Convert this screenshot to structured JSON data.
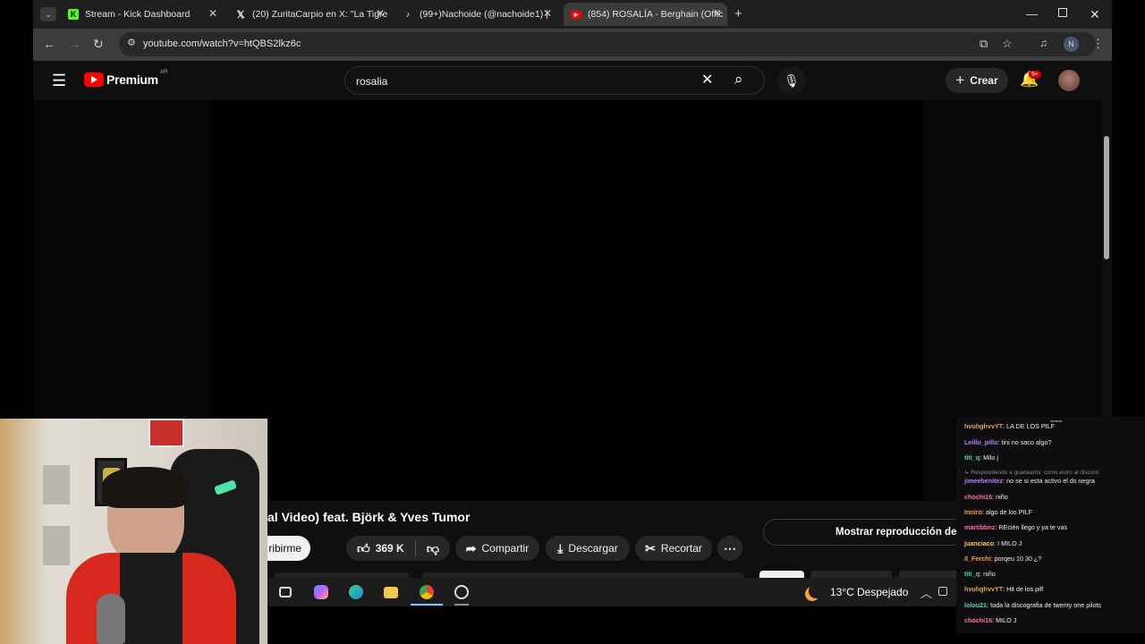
{
  "browser": {
    "tabs": [
      {
        "title": "Stream - Kick Dashboard",
        "active": false
      },
      {
        "title": "(20) ZuritaCarpio en X: \"La Tigre",
        "active": false
      },
      {
        "title": "(99+)Nachoide (@nachoide1) |",
        "active": false
      },
      {
        "title": "(854) ROSALÍA - Berghain (Offic",
        "active": true
      }
    ],
    "url": "youtube.com/watch?v=htQBS2lkz6c",
    "profile_initial": "N"
  },
  "youtube": {
    "logo_text": "Premium",
    "region": "AR",
    "search_value": "rosalia",
    "create_label": "Crear",
    "notif_badge": "9+",
    "video_title": "al Video) feat. Björk & Yves Tumor",
    "subscribe_label": "ribirme",
    "likes": "369 K",
    "share_label": "Compartir",
    "download_label": "Descargar",
    "clip_label": "Recortar",
    "chat_replay_label": "Mostrar reproducción del ch"
  },
  "taskbar": {
    "temperature": "13°C",
    "weather": "Despejado"
  },
  "chat": {
    "messages": [
      {
        "user": "hvuhghvvYT",
        "text": ": LA DE LOS PILF",
        "color": "#e2a34a"
      },
      {
        "user": "Leillo_pillo",
        "text": ": tini no saco algo?",
        "color": "#b77cff"
      },
      {
        "user": "titi_q",
        "text": ": Milo j",
        "color": "#5ad1b5"
      },
      {
        "user": "",
        "text": "↳ Respondiendo a guadaants: como entro al discord",
        "color": "#8a8a8a"
      },
      {
        "user": "jimeebenitez",
        "text": ": no se si esta activo el ds negra",
        "color": "#b77cff"
      },
      {
        "user": "chochi16",
        "text": ": niño",
        "color": "#ff6ea8"
      },
      {
        "user": "Inniro",
        "text": ": algo de los PILF",
        "color": "#ff9f40"
      },
      {
        "user": "martibbnz",
        "text": ": REcién llego y ya te vas",
        "color": "#ff6ea8"
      },
      {
        "user": "juanciaco",
        "text": ": I MILO J",
        "color": "#ffcc44"
      },
      {
        "user": "Il_Ferchi",
        "text": ": porqeu 10 30 ¿?",
        "color": "#ff9f40"
      },
      {
        "user": "titi_q",
        "text": ": niño",
        "color": "#5ad1b5"
      },
      {
        "user": "hvuhghvvYT",
        "text": ": Hit de los pilf",
        "color": "#e2a34a"
      },
      {
        "user": "lolou21",
        "text": ": toda la discografia de twenty one pilots",
        "color": "#5ad1b5"
      },
      {
        "user": "chochi16",
        "text": ": MILO J",
        "color": "#ff6ea8"
      }
    ]
  }
}
